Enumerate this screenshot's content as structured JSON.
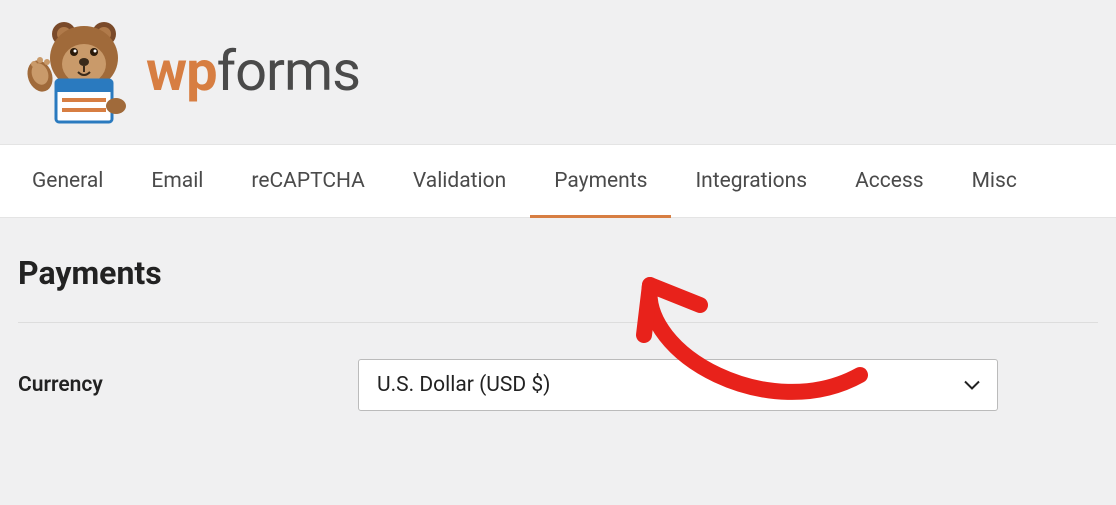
{
  "brand": {
    "wp": "wp",
    "forms": "forms"
  },
  "tabs": [
    {
      "label": "General",
      "active": false
    },
    {
      "label": "Email",
      "active": false
    },
    {
      "label": "reCAPTCHA",
      "active": false
    },
    {
      "label": "Validation",
      "active": false
    },
    {
      "label": "Payments",
      "active": true
    },
    {
      "label": "Integrations",
      "active": false
    },
    {
      "label": "Access",
      "active": false
    },
    {
      "label": "Misc",
      "active": false
    }
  ],
  "section": {
    "title": "Payments"
  },
  "form": {
    "currency_label": "Currency",
    "currency_value": "U.S. Dollar (USD $)"
  },
  "colors": {
    "accent": "#d77e42",
    "annotation": "#e8221b"
  }
}
